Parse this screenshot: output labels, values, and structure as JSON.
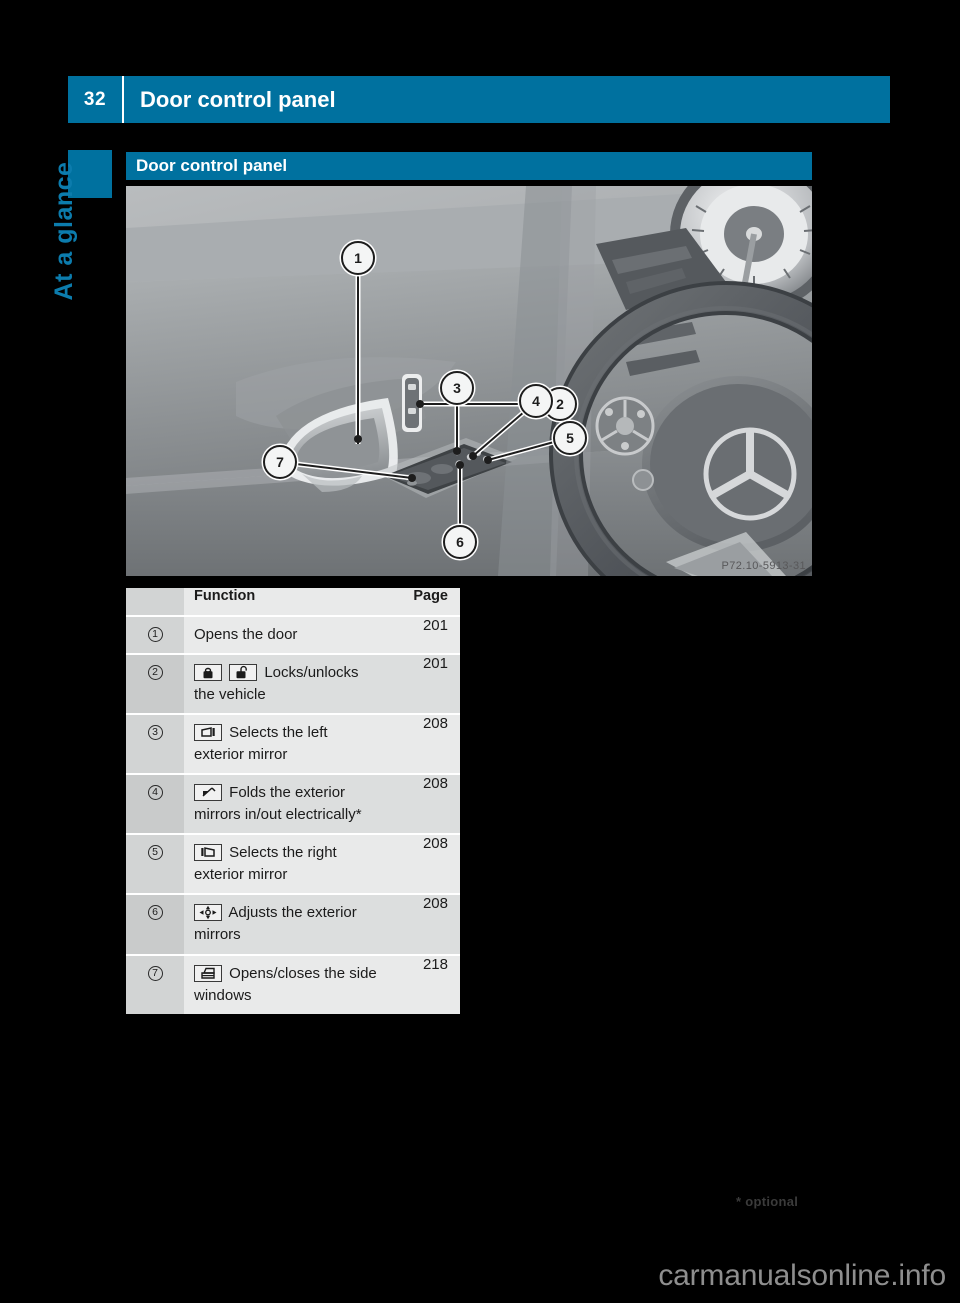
{
  "header": {
    "page_number": "32",
    "title": "Door control panel"
  },
  "side_tab": {
    "label": "At a glance"
  },
  "section": {
    "title": "Door control panel"
  },
  "photo": {
    "reference_code": "P72.10-5913-31",
    "callout_labels": [
      "1",
      "2",
      "3",
      "4",
      "5",
      "6",
      "7"
    ],
    "description": "Driver's door control panel with steering wheel"
  },
  "table": {
    "columns": [
      "",
      "Function",
      "Page"
    ],
    "rows": [
      {
        "num": "1",
        "icons": [],
        "text": "Opens the door",
        "page": "201"
      },
      {
        "num": "2",
        "icons": [
          "lock-closed-icon",
          "lock-open-icon"
        ],
        "text": "Locks/unlocks the vehicle",
        "page": "201"
      },
      {
        "num": "3",
        "icons": [
          "left-exterior-mirror-icon"
        ],
        "text": "Selects the left exterior mirror",
        "page": "208"
      },
      {
        "num": "4",
        "icons": [
          "fold-mirror-icon"
        ],
        "text": "Folds the exterior mirrors in/out electrically*",
        "page": "208"
      },
      {
        "num": "5",
        "icons": [
          "right-exterior-mirror-icon"
        ],
        "text": "Selects the right exterior mirror",
        "page": "208"
      },
      {
        "num": "6",
        "icons": [
          "four-way-adjust-icon"
        ],
        "text": "Adjusts the exterior mirrors",
        "page": "208"
      },
      {
        "num": "7",
        "icons": [
          "side-window-icon"
        ],
        "text": "Opens/closes the side windows",
        "page": "218"
      }
    ]
  },
  "footnote": {
    "text": "* optional"
  },
  "watermark": {
    "text": "carmanualsonline.info"
  },
  "colors": {
    "brand_blue": "#00719f",
    "side_tab_text": "#0c7cad",
    "page_background": "#000000",
    "table_row_light": "#e9eaea",
    "table_row_dark": "#dcdede"
  }
}
